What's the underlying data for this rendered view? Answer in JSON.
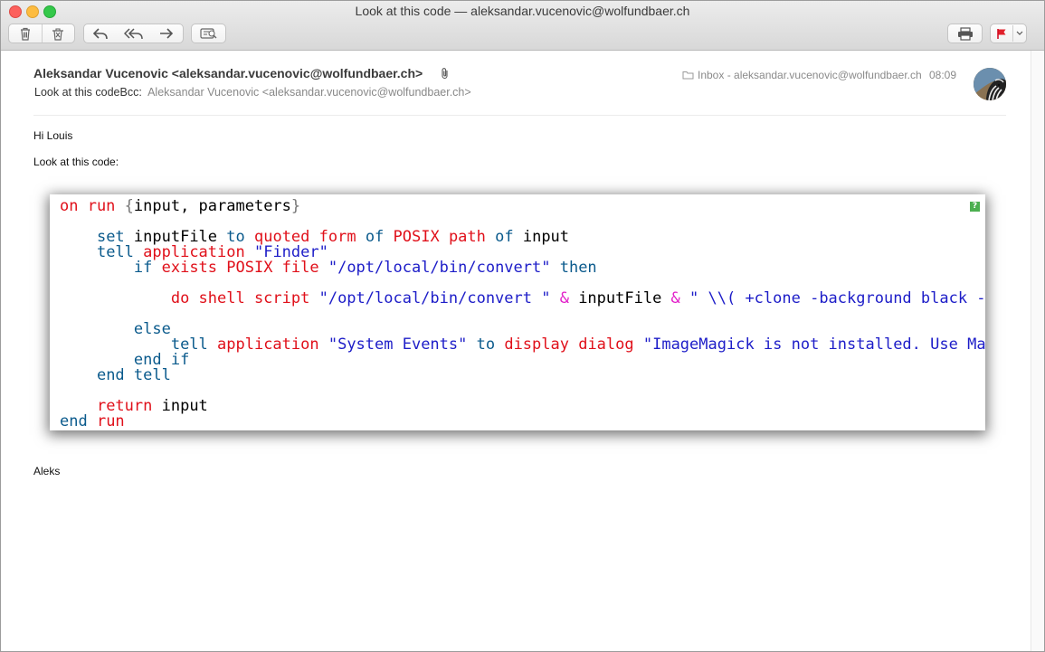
{
  "window": {
    "title": "Look at this code — aleksandar.vucenovic@wolfundbaer.ch"
  },
  "toolbar": {
    "buttons": [
      "delete",
      "junk",
      "reply",
      "reply-all",
      "forward",
      "move",
      "print",
      "flag"
    ]
  },
  "message": {
    "from": "Aleksandar Vucenovic <aleksandar.vucenovic@wolfundbaer.ch>",
    "subject": "Look at this code",
    "bcc_label": "Bcc:",
    "bcc_value": "Aleksandar Vucenovic <aleksandar.vucenovic@wolfundbaer.ch>",
    "mailbox": "Inbox - aleksandar.vucenovic@wolfundbaer.ch",
    "time": "08:09"
  },
  "body": {
    "greeting": "Hi Louis",
    "intro": "Look at this code:",
    "signature": "Aleks"
  },
  "code": {
    "help": "?",
    "lines": [
      [
        {
          "t": "cmd",
          "v": "on run "
        },
        {
          "t": "br",
          "v": "{"
        },
        {
          "t": "plain",
          "v": "input, parameters"
        },
        {
          "t": "br",
          "v": "}"
        }
      ],
      [],
      [
        {
          "t": "plain",
          "v": "    "
        },
        {
          "t": "kw",
          "v": "set "
        },
        {
          "t": "plain",
          "v": "inputFile "
        },
        {
          "t": "kw",
          "v": "to "
        },
        {
          "t": "cmd",
          "v": "quoted form "
        },
        {
          "t": "kw",
          "v": "of "
        },
        {
          "t": "cmd",
          "v": "POSIX path "
        },
        {
          "t": "kw",
          "v": "of "
        },
        {
          "t": "plain",
          "v": "input"
        }
      ],
      [
        {
          "t": "plain",
          "v": "    "
        },
        {
          "t": "kw",
          "v": "tell "
        },
        {
          "t": "cmd",
          "v": "application "
        },
        {
          "t": "str",
          "v": "\"Finder\""
        }
      ],
      [
        {
          "t": "plain",
          "v": "        "
        },
        {
          "t": "kw",
          "v": "if "
        },
        {
          "t": "cmd",
          "v": "exists POSIX file "
        },
        {
          "t": "str",
          "v": "\"/opt/local/bin/convert\" "
        },
        {
          "t": "kw",
          "v": "then"
        }
      ],
      [],
      [
        {
          "t": "plain",
          "v": "            "
        },
        {
          "t": "cmd",
          "v": "do shell script "
        },
        {
          "t": "str",
          "v": "\"/opt/local/bin/convert \" "
        },
        {
          "t": "amp",
          "v": "& "
        },
        {
          "t": "plain",
          "v": "inputFile "
        },
        {
          "t": "amp",
          "v": "& "
        },
        {
          "t": "str",
          "v": "\" \\\\( +clone -background black -shadow"
        }
      ],
      [],
      [
        {
          "t": "plain",
          "v": "        "
        },
        {
          "t": "kw",
          "v": "else"
        }
      ],
      [
        {
          "t": "plain",
          "v": "            "
        },
        {
          "t": "kw",
          "v": "tell "
        },
        {
          "t": "cmd",
          "v": "application "
        },
        {
          "t": "str",
          "v": "\"System Events\" "
        },
        {
          "t": "kw",
          "v": "to "
        },
        {
          "t": "cmd",
          "v": "display dialog "
        },
        {
          "t": "str",
          "v": "\"ImageMagick is not installed. Use MacPorts"
        }
      ],
      [
        {
          "t": "plain",
          "v": "        "
        },
        {
          "t": "kw",
          "v": "end if"
        }
      ],
      [
        {
          "t": "plain",
          "v": "    "
        },
        {
          "t": "kw",
          "v": "end tell"
        }
      ],
      [],
      [
        {
          "t": "plain",
          "v": "    "
        },
        {
          "t": "cmd",
          "v": "return "
        },
        {
          "t": "plain",
          "v": "input"
        }
      ],
      [
        {
          "t": "kw",
          "v": "end "
        },
        {
          "t": "cmd",
          "v": "run"
        }
      ]
    ]
  }
}
